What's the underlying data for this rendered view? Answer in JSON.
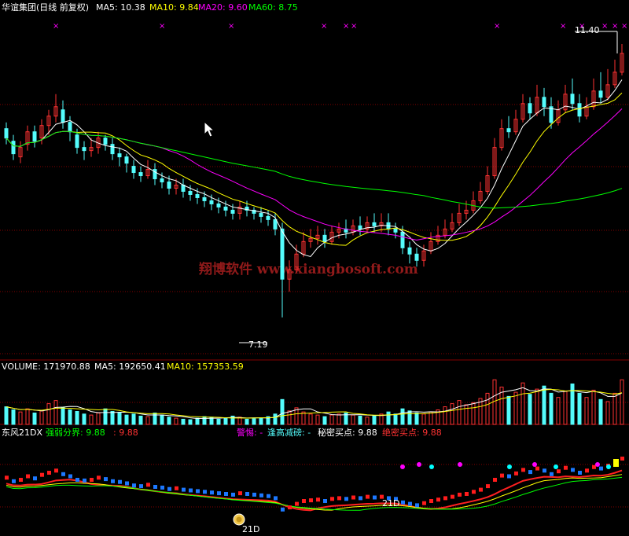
{
  "colors": {
    "background": "#000000",
    "up": "#ff3232",
    "down": "#54fcfc",
    "ma5": "#ffffff",
    "ma10": "#ffff00",
    "ma20": "#ff00ff",
    "ma60": "#00ff00",
    "grid": "#840000",
    "label_white": "#ffffff",
    "signal": "#ff00ff"
  },
  "header": {
    "title": "华谊集团(日线 前复权)",
    "ma5": "MA5: 10.38",
    "ma10": "MA10: 9.84",
    "ma20": "MA20: 9.60",
    "ma60": "MA60: 8.75"
  },
  "watermark": "翔博软件 www.xiangbosoft.com",
  "chart_data": [
    {
      "type": "candlestick",
      "panel": "price",
      "y_axis_labels": [
        "11.40",
        "7.19"
      ],
      "ylim": [
        6.8,
        11.7
      ],
      "series_labels": [
        "MA5",
        "MA10",
        "MA20",
        "MA60"
      ],
      "signals": [
        "×",
        "×",
        "×",
        "×",
        "×",
        "×",
        "×",
        "×",
        "×",
        "×",
        "×",
        "×"
      ],
      "signal_positions": [
        67,
        202,
        290,
        408,
        436,
        446,
        628,
        712,
        736,
        765,
        778,
        790
      ],
      "candles": [
        [
          10.2,
          10.05,
          10.3,
          9.95
        ],
        [
          10.0,
          9.8,
          10.1,
          9.7
        ],
        [
          9.75,
          9.9,
          10.0,
          9.65
        ],
        [
          9.95,
          10.15,
          10.25,
          9.85
        ],
        [
          10.15,
          10.0,
          10.25,
          9.9
        ],
        [
          10.05,
          10.25,
          10.35,
          9.95
        ],
        [
          10.25,
          10.4,
          10.5,
          10.1
        ],
        [
          10.4,
          10.55,
          10.75,
          10.3
        ],
        [
          10.5,
          10.3,
          10.65,
          10.2
        ],
        [
          10.3,
          10.15,
          10.4,
          10.0
        ],
        [
          10.1,
          9.9,
          10.2,
          9.8
        ],
        [
          9.9,
          9.85,
          10.0,
          9.7
        ],
        [
          9.85,
          9.9,
          10.05,
          9.75
        ],
        [
          9.9,
          10.05,
          10.15,
          9.8
        ],
        [
          10.05,
          9.95,
          10.1,
          9.85
        ],
        [
          9.95,
          9.8,
          10.05,
          9.7
        ],
        [
          9.8,
          9.75,
          9.9,
          9.6
        ],
        [
          9.75,
          9.65,
          9.8,
          9.5
        ],
        [
          9.6,
          9.5,
          9.7,
          9.4
        ],
        [
          9.5,
          9.45,
          9.6,
          9.35
        ],
        [
          9.45,
          9.55,
          9.7,
          9.4
        ],
        [
          9.55,
          9.4,
          9.65,
          9.3
        ],
        [
          9.4,
          9.35,
          9.5,
          9.25
        ],
        [
          9.35,
          9.25,
          9.45,
          9.15
        ],
        [
          9.25,
          9.3,
          9.4,
          9.15
        ],
        [
          9.3,
          9.2,
          9.4,
          9.1
        ],
        [
          9.2,
          9.15,
          9.3,
          9.05
        ],
        [
          9.15,
          9.1,
          9.25,
          9.0
        ],
        [
          9.1,
          9.05,
          9.2,
          8.95
        ],
        [
          9.05,
          9.0,
          9.15,
          8.9
        ],
        [
          9.0,
          8.95,
          9.1,
          8.85
        ],
        [
          8.95,
          8.9,
          9.05,
          8.8
        ],
        [
          8.9,
          8.85,
          9.0,
          8.75
        ],
        [
          8.85,
          8.95,
          9.05,
          8.75
        ],
        [
          8.95,
          8.9,
          9.05,
          8.8
        ],
        [
          8.9,
          8.85,
          8.95,
          8.75
        ],
        [
          8.85,
          8.8,
          8.95,
          8.7
        ],
        [
          8.8,
          8.75,
          8.9,
          8.65
        ],
        [
          8.75,
          8.6,
          8.85,
          8.5
        ],
        [
          8.6,
          7.8,
          8.7,
          7.19
        ],
        [
          7.8,
          7.95,
          8.1,
          7.6
        ],
        [
          7.95,
          8.2,
          8.35,
          7.9
        ],
        [
          8.2,
          8.4,
          8.55,
          8.15
        ],
        [
          8.4,
          8.45,
          8.6,
          8.3
        ],
        [
          8.45,
          8.5,
          8.65,
          8.35
        ],
        [
          8.5,
          8.4,
          8.6,
          8.3
        ],
        [
          8.4,
          8.55,
          8.65,
          8.35
        ],
        [
          8.55,
          8.6,
          8.7,
          8.45
        ],
        [
          8.6,
          8.55,
          8.75,
          8.45
        ],
        [
          8.55,
          8.65,
          8.75,
          8.5
        ],
        [
          8.65,
          8.6,
          8.8,
          8.5
        ],
        [
          8.6,
          8.7,
          8.8,
          8.55
        ],
        [
          8.7,
          8.65,
          8.85,
          8.55
        ],
        [
          8.65,
          8.7,
          8.85,
          8.55
        ],
        [
          8.7,
          8.6,
          8.85,
          8.5
        ],
        [
          8.6,
          8.55,
          8.7,
          8.45
        ],
        [
          8.55,
          8.3,
          8.65,
          8.2
        ],
        [
          8.3,
          8.2,
          8.4,
          8.05
        ],
        [
          8.2,
          8.1,
          8.3,
          8.0
        ],
        [
          8.1,
          8.25,
          8.35,
          8.0
        ],
        [
          8.25,
          8.4,
          8.55,
          8.2
        ],
        [
          8.4,
          8.5,
          8.65,
          8.35
        ],
        [
          8.5,
          8.6,
          8.75,
          8.45
        ],
        [
          8.6,
          8.7,
          8.85,
          8.55
        ],
        [
          8.7,
          8.85,
          9.0,
          8.65
        ],
        [
          8.85,
          8.9,
          9.05,
          8.75
        ],
        [
          8.9,
          9.05,
          9.2,
          8.85
        ],
        [
          9.05,
          9.2,
          9.35,
          9.0
        ],
        [
          9.2,
          9.45,
          9.6,
          9.15
        ],
        [
          9.45,
          9.9,
          10.05,
          9.4
        ],
        [
          9.9,
          10.2,
          10.35,
          9.85
        ],
        [
          10.2,
          10.15,
          10.4,
          10.05
        ],
        [
          10.15,
          10.35,
          10.5,
          10.1
        ],
        [
          10.35,
          10.6,
          10.75,
          10.3
        ],
        [
          10.6,
          10.45,
          10.7,
          10.35
        ],
        [
          10.45,
          10.7,
          10.9,
          10.4
        ],
        [
          10.7,
          10.55,
          10.85,
          10.4
        ],
        [
          10.55,
          10.3,
          10.7,
          10.2
        ],
        [
          10.3,
          10.5,
          10.65,
          10.25
        ],
        [
          10.5,
          10.75,
          10.9,
          10.45
        ],
        [
          10.75,
          10.6,
          11.0,
          10.5
        ],
        [
          10.6,
          10.4,
          10.75,
          10.3
        ],
        [
          10.4,
          10.55,
          10.7,
          10.35
        ],
        [
          10.55,
          10.8,
          11.0,
          10.5
        ],
        [
          10.8,
          10.7,
          11.1,
          10.6
        ],
        [
          10.7,
          10.9,
          11.15,
          10.65
        ],
        [
          10.9,
          11.1,
          11.3,
          10.85
        ],
        [
          11.1,
          11.4,
          11.55,
          11.05
        ]
      ]
    },
    {
      "type": "bar",
      "panel": "volume",
      "labels": {
        "volume": "VOLUME: 171970.88",
        "ma5": "MA5: 192650.41",
        "ma10": "MA10: 157353.59"
      },
      "values": [
        0.34,
        0.28,
        0.24,
        0.3,
        0.22,
        0.26,
        0.4,
        0.46,
        0.33,
        0.28,
        0.25,
        0.2,
        0.18,
        0.22,
        0.3,
        0.25,
        0.22,
        0.18,
        0.2,
        0.16,
        0.15,
        0.22,
        0.18,
        0.14,
        0.12,
        0.1,
        0.09,
        0.12,
        0.15,
        0.14,
        0.1,
        0.12,
        0.16,
        0.14,
        0.1,
        0.11,
        0.12,
        0.15,
        0.2,
        0.48,
        0.26,
        0.32,
        0.24,
        0.2,
        0.18,
        0.15,
        0.18,
        0.2,
        0.22,
        0.18,
        0.16,
        0.14,
        0.17,
        0.2,
        0.24,
        0.2,
        0.3,
        0.26,
        0.22,
        0.2,
        0.24,
        0.28,
        0.34,
        0.4,
        0.46,
        0.38,
        0.42,
        0.5,
        0.6,
        0.86,
        0.72,
        0.54,
        0.62,
        0.8,
        0.58,
        0.68,
        0.74,
        0.6,
        0.52,
        0.64,
        0.78,
        0.6,
        0.52,
        0.66,
        0.48,
        0.44,
        0.6,
        0.86
      ]
    },
    {
      "type": "bar",
      "panel": "dongfeng21",
      "labels": {
        "title": "东风21DX",
        "strength": "强弱分界: 9.88",
        "strength_red": ": 9.88",
        "warning": "警惕: -",
        "high_reduce": "逢高减磅: -",
        "secret_buy": "秘密买点: 9.88",
        "absolute_buy": "绝密买点: 9.88"
      },
      "annotations": [
        "21D",
        "21D"
      ]
    }
  ]
}
